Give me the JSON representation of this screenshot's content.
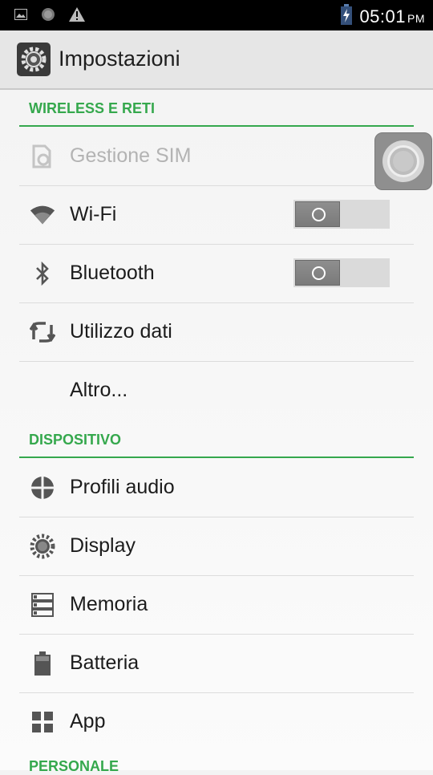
{
  "status_bar": {
    "time": "05:01",
    "ampm": "PM",
    "icons": [
      "image-icon",
      "circle-icon",
      "warning-icon",
      "battery-charging-icon"
    ]
  },
  "action_bar": {
    "title": "Impostazioni",
    "icon": "settings-gear-icon"
  },
  "sections": {
    "wireless": {
      "header": "WIRELESS E RETI",
      "items": [
        {
          "label": "Gestione SIM",
          "icon": "sim-icon",
          "enabled": false
        },
        {
          "label": "Wi-Fi",
          "icon": "wifi-icon",
          "toggle": "off"
        },
        {
          "label": "Bluetooth",
          "icon": "bluetooth-icon",
          "toggle": "off"
        },
        {
          "label": "Utilizzo dati",
          "icon": "data-usage-icon"
        },
        {
          "label": "Altro...",
          "icon": ""
        }
      ]
    },
    "device": {
      "header": "DISPOSITIVO",
      "items": [
        {
          "label": "Profili audio",
          "icon": "audio-profiles-icon"
        },
        {
          "label": "Display",
          "icon": "display-brightness-icon"
        },
        {
          "label": "Memoria",
          "icon": "storage-icon"
        },
        {
          "label": "Batteria",
          "icon": "battery-icon"
        },
        {
          "label": "App",
          "icon": "apps-icon"
        }
      ]
    },
    "personal": {
      "header": "PERSONALE"
    }
  },
  "colors": {
    "accent": "#35a84d",
    "status_bar": "#000000",
    "action_bar": "#e6e6e6"
  }
}
